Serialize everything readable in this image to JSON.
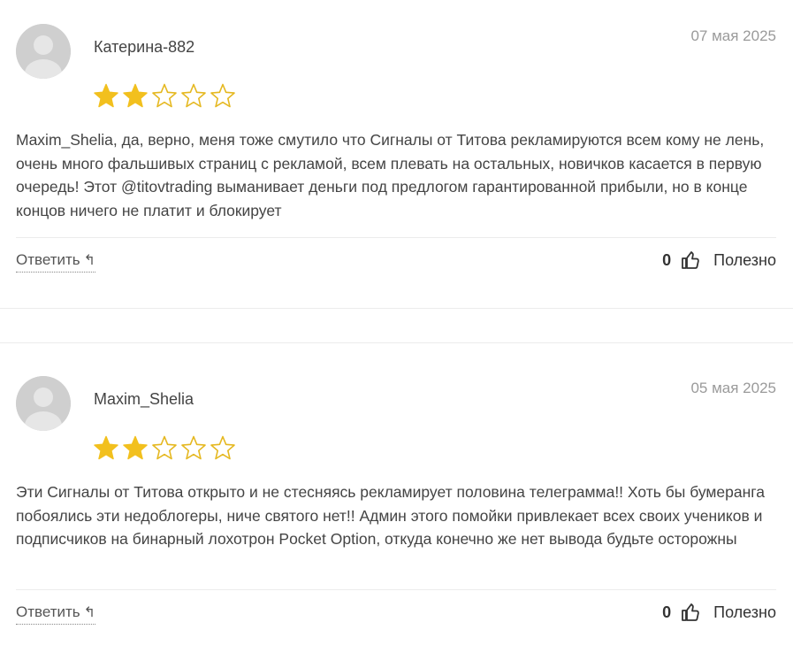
{
  "colors": {
    "star_filled": "#F2C01E",
    "star_empty_stroke": "#E5B820",
    "avatar_bg": "#CFCFCF",
    "divider": "#ECECEC",
    "date_text": "#9A9A9A"
  },
  "reviews": [
    {
      "author": "Катерина-882",
      "date": "07 мая 2025",
      "rating": 2,
      "max_rating": 5,
      "text": "Maxim_Shelia, да, верно, меня тоже смутило что Сигналы от Титова рекламируются всем кому не лень, очень много фальшивых страниц с рекламой, всем плевать на остальных, новичков касается в первую очередь! Этот @titovtrading выманивает деньги под предлогом гарантированной прибыли, но в конце концов ничего не платит и блокирует",
      "reply_label": "Ответить",
      "reply_icon": "↰",
      "helpful_count": "0",
      "helpful_label": "Полезно",
      "helpful_icon": "thumbs-up-icon",
      "avatar_icon": "user-silhouette-icon"
    },
    {
      "author": "Maxim_Shelia",
      "date": "05 мая 2025",
      "rating": 2,
      "max_rating": 5,
      "text": "Эти Сигналы от Титова открыто и не стесняясь рекламирует половина телеграмма!! Хоть бы бумеранга побоялись эти недоблогеры, ниче святого нет!! Админ этого помойки привлекает всех своих учеников и подписчиков на бинарный лохотрон Pocket Option, откуда конечно же нет вывода будьте осторожны",
      "reply_label": "Ответить",
      "reply_icon": "↰",
      "helpful_count": "0",
      "helpful_label": "Полезно",
      "helpful_icon": "thumbs-up-icon",
      "avatar_icon": "user-silhouette-icon"
    }
  ]
}
